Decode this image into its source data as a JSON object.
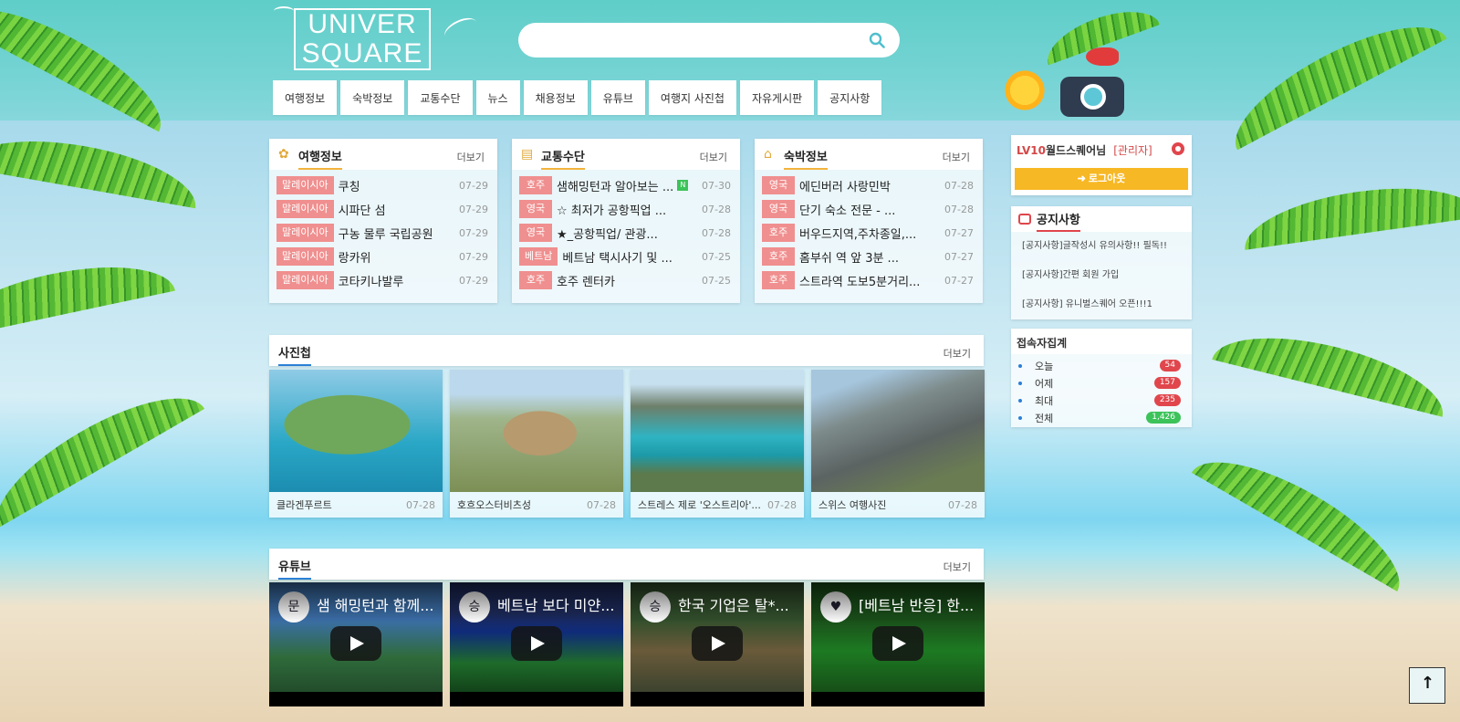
{
  "logo": {
    "line1": "UNIVER",
    "line2": "SQUARE"
  },
  "search": {
    "value": ""
  },
  "nav": [
    "여행정보",
    "숙박정보",
    "교통수단",
    "뉴스",
    "채용정보",
    "유튜브",
    "여행지 사진첩",
    "자유게시판",
    "공지사항"
  ],
  "more_label": "더보기",
  "travel": {
    "title": "여행정보",
    "items": [
      {
        "tag": "말레이시아",
        "text": "쿠칭",
        "date": "07-29"
      },
      {
        "tag": "말레이시아",
        "text": "시파단 섬",
        "date": "07-29"
      },
      {
        "tag": "말레이시아",
        "text": "구농 물루 국립공원",
        "date": "07-29"
      },
      {
        "tag": "말레이시아",
        "text": "랑카위",
        "date": "07-29"
      },
      {
        "tag": "말레이시아",
        "text": "코타키나발루",
        "date": "07-29"
      }
    ]
  },
  "transport": {
    "title": "교통수단",
    "items": [
      {
        "tag": "호주",
        "text": "샘해밍턴과 알아보는 ...",
        "date": "07-30",
        "badge": "N"
      },
      {
        "tag": "영국",
        "text": "☆ 최저가 공항픽업 ...",
        "date": "07-28"
      },
      {
        "tag": "영국",
        "text": "★_공항픽업/ 관광...",
        "date": "07-28"
      },
      {
        "tag": "베트남",
        "text": "베트남 택시사기 및 ...",
        "date": "07-25"
      },
      {
        "tag": "호주",
        "text": "호주 렌터카",
        "date": "07-25"
      }
    ]
  },
  "lodging": {
    "title": "숙박정보",
    "items": [
      {
        "tag": "영국",
        "text": "에딘버러 사랑민박",
        "date": "07-28"
      },
      {
        "tag": "영국",
        "text": "단기 숙소 전문 - ...",
        "date": "07-28"
      },
      {
        "tag": "호주",
        "text": "버우드지역,주차종일,...",
        "date": "07-27"
      },
      {
        "tag": "호주",
        "text": "홈부쉬 역 앞 3분 ...",
        "date": "07-27"
      },
      {
        "tag": "호주",
        "text": "스트라역 도보5분거리...",
        "date": "07-27"
      }
    ]
  },
  "photos": {
    "title": "사진첩",
    "items": [
      {
        "caption": "클라겐푸르트",
        "date": "07-28"
      },
      {
        "caption": "호흐오스터비츠성",
        "date": "07-28"
      },
      {
        "caption": "스트레스 제로 '오스트리아'...",
        "date": "07-28"
      },
      {
        "caption": "스위스 여행사진",
        "date": "07-28"
      }
    ]
  },
  "youtube": {
    "title": "유튜브",
    "items": [
      {
        "video_title": "샘 해밍턴과 함께...",
        "channel": "문"
      },
      {
        "video_title": "베트남 보다 미얀...",
        "channel": "승"
      },
      {
        "video_title": "한국 기업은 탈*...",
        "channel": "승"
      },
      {
        "video_title": "[베트남 반응] 한...",
        "channel": "♥"
      }
    ]
  },
  "user": {
    "level": "LV10",
    "name": "월드스퀘어님",
    "role": "[관리자]",
    "logout_label": "로그아웃"
  },
  "notice": {
    "title": "공지사항",
    "items": [
      "[공지사항]글작성시 유의사항!! 필독!!",
      "[공지사항]간편 회원 가입",
      "[공지사항] 유니벌스퀘어 오픈!!!1"
    ]
  },
  "stats": {
    "title": "접속자집계",
    "items": [
      {
        "label": "오늘",
        "value": "54",
        "color": "#e0464c"
      },
      {
        "label": "어제",
        "value": "157",
        "color": "#e0464c"
      },
      {
        "label": "최대",
        "value": "235",
        "color": "#e0464c"
      },
      {
        "label": "전체",
        "value": "1,426",
        "color": "#3cc35a"
      }
    ]
  }
}
